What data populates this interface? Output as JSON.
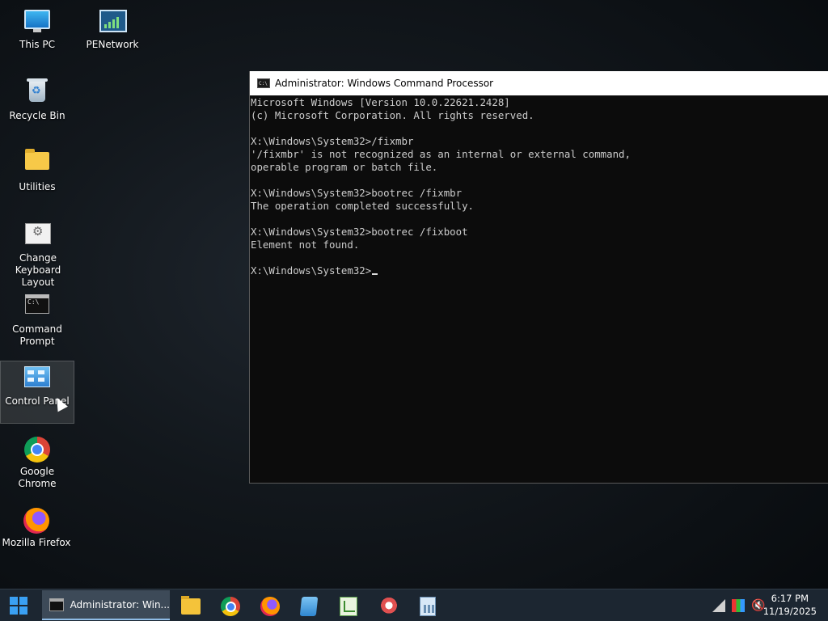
{
  "desktop": {
    "icons": [
      {
        "label": "This PC",
        "icon": "computer-icon"
      },
      {
        "label": "PENetwork",
        "icon": "network-icon"
      },
      {
        "label": "Recycle Bin",
        "icon": "recycle-bin-icon"
      },
      {
        "label": "Utilities",
        "icon": "folder-icon"
      },
      {
        "label": "Change Keyboard Layout",
        "icon": "keyboard-settings-icon"
      },
      {
        "label": "Command Prompt",
        "icon": "command-prompt-icon"
      },
      {
        "label": "Control Panel",
        "icon": "control-panel-icon"
      },
      {
        "label": "Google Chrome",
        "icon": "chrome-icon"
      },
      {
        "label": "Mozilla Firefox",
        "icon": "firefox-icon"
      }
    ]
  },
  "console": {
    "title": "Administrator: Windows Command Processor",
    "icon_text": "C:\\",
    "lines": [
      "Microsoft Windows [Version 10.0.22621.2428]",
      "(c) Microsoft Corporation. All rights reserved.",
      "",
      "X:\\Windows\\System32>/fixmbr",
      "'/fixmbr' is not recognized as an internal or external command,",
      "operable program or batch file.",
      "",
      "X:\\Windows\\System32>bootrec /fixmbr",
      "The operation completed successfully.",
      "",
      "X:\\Windows\\System32>bootrec /fixboot",
      "Element not found.",
      "",
      "X:\\Windows\\System32>"
    ]
  },
  "taskbar": {
    "active_task_label": "Administrator: Win...",
    "pinned": [
      "file-explorer-icon",
      "chrome-icon",
      "firefox-icon",
      "notepad-icon",
      "spreadsheet-icon",
      "tool-icon",
      "calculator-icon"
    ],
    "tray": {
      "time": "6:17 PM",
      "date": "11/19/2025"
    }
  }
}
